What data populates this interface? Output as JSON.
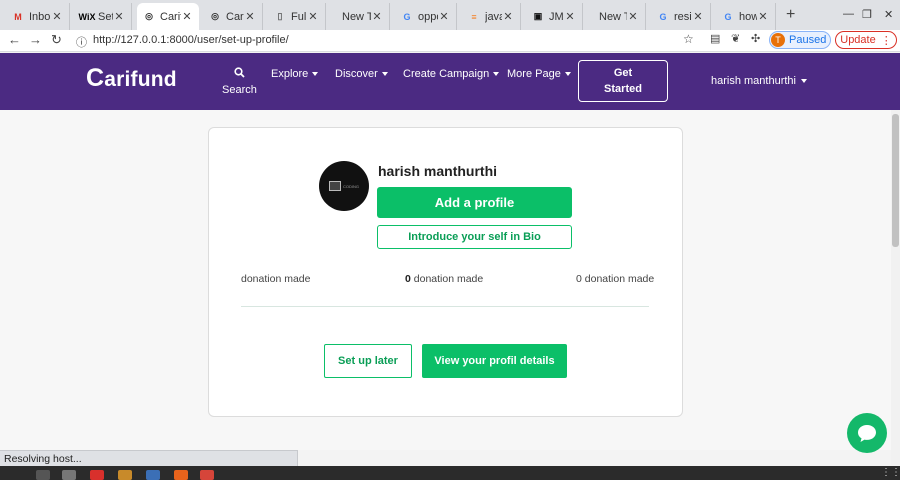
{
  "browser": {
    "tabs": [
      {
        "label": "Inbo",
        "icon": "gmail-icon",
        "favicon_text": "M",
        "favicon_color": "#d93025"
      },
      {
        "label": "Set u",
        "icon": "wix-icon",
        "favicon_text": "WiX",
        "favicon_color": "#000000"
      },
      {
        "label": "Carif",
        "icon": "globe-icon",
        "favicon_text": "◎",
        "favicon_color": "#333333",
        "active": true
      },
      {
        "label": "Carif",
        "icon": "globe-icon",
        "favicon_text": "◎",
        "favicon_color": "#333333"
      },
      {
        "label": "Full S",
        "icon": "chart-icon",
        "favicon_text": "▯",
        "favicon_color": "#666666"
      },
      {
        "label": "New Tab",
        "icon": "none",
        "favicon_text": "",
        "favicon_color": "#333333"
      },
      {
        "label": "oppo",
        "icon": "google-icon",
        "favicon_text": "G",
        "favicon_color": "#4285f4"
      },
      {
        "label": "javas",
        "icon": "stackoverflow-icon",
        "favicon_text": "≡",
        "favicon_color": "#f48024"
      },
      {
        "label": "JMD",
        "icon": "jmd-icon",
        "favicon_text": "▣",
        "favicon_color": "#111111"
      },
      {
        "label": "New Tab",
        "icon": "none",
        "favicon_text": "",
        "favicon_color": "#333333"
      },
      {
        "label": "resig",
        "icon": "google-icon",
        "favicon_text": "G",
        "favicon_color": "#4285f4"
      },
      {
        "label": "how",
        "icon": "google-icon",
        "favicon_text": "G",
        "favicon_color": "#4285f4"
      }
    ],
    "url": "http://127.0.0.1:8000/user/set-up-profile/",
    "paused_label": "Paused",
    "paused_avatar": "T",
    "update_label": "Update"
  },
  "nav": {
    "logo_c": "C",
    "logo_rest": "arifund",
    "search_label": "Search",
    "explore": "Explore",
    "discover": "Discover",
    "create_campaign": "Create Campaign",
    "more_page": "More Page",
    "get_started_line1": "Get",
    "get_started_line2": "Started",
    "username": "harish manthurthi"
  },
  "profile": {
    "name": "harish manthurthi",
    "add_profile": "Add a profile",
    "bio": "Introduce your self in Bio",
    "stats": [
      {
        "count": "",
        "label": "donation made"
      },
      {
        "count": "0",
        "label": "donation made"
      },
      {
        "count": "0",
        "label": "donation made"
      }
    ],
    "setup_later": "Set up later",
    "view_details": "View your profil details"
  },
  "status_text": "Resolving host...",
  "colors": {
    "brand_purple": "#4b2a82",
    "accent_green": "#0bbf68"
  }
}
